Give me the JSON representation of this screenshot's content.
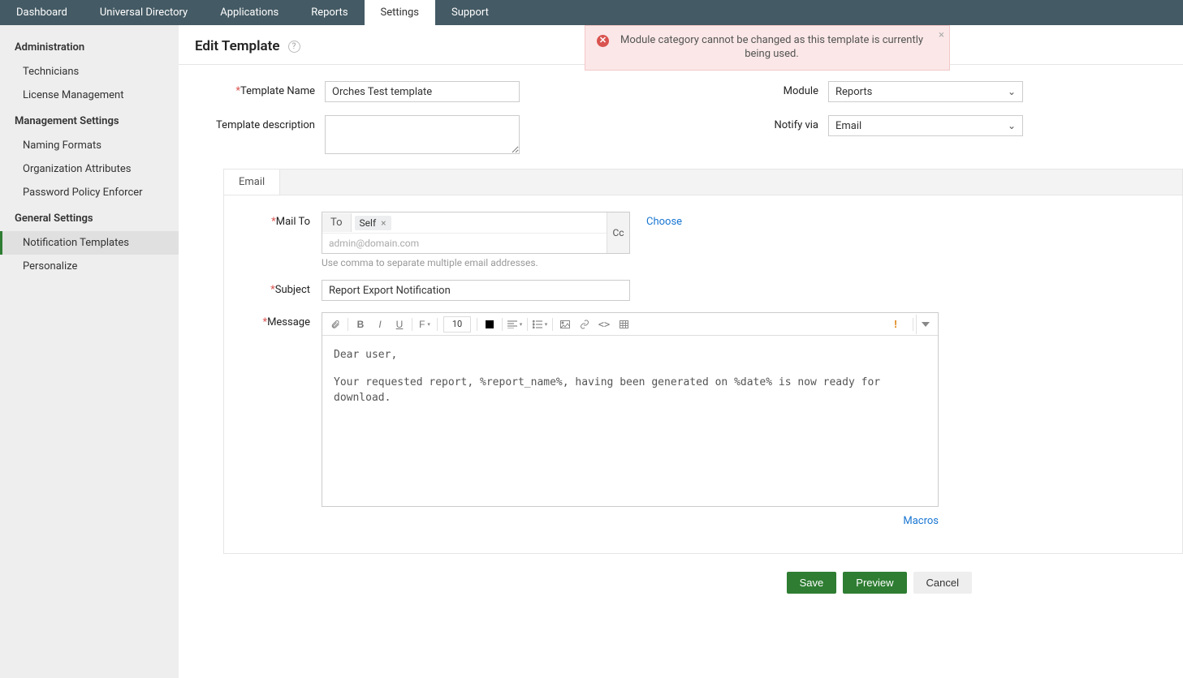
{
  "topnav": {
    "tabs": [
      "Dashboard",
      "Universal Directory",
      "Applications",
      "Reports",
      "Settings",
      "Support"
    ],
    "active_index": 4
  },
  "sidebar": {
    "sections": [
      {
        "title": "Administration",
        "items": [
          "Technicians",
          "License Management"
        ]
      },
      {
        "title": "Management Settings",
        "items": [
          "Naming Formats",
          "Organization Attributes",
          "Password Policy Enforcer"
        ]
      },
      {
        "title": "General Settings",
        "items": [
          "Notification Templates",
          "Personalize"
        ]
      }
    ],
    "active": "Notification Templates"
  },
  "page": {
    "title": "Edit Template"
  },
  "alert": {
    "message": "Module category cannot be changed as this template is currently being used."
  },
  "form": {
    "template_name": {
      "label": "Template Name",
      "value": "Orches Test template",
      "required": true
    },
    "template_description": {
      "label": "Template description",
      "value": "",
      "required": false
    },
    "module": {
      "label": "Module",
      "value": "Reports",
      "required": false
    },
    "notify_via": {
      "label": "Notify via",
      "value": "Email",
      "required": false
    }
  },
  "email_tab": {
    "tab_label": "Email",
    "mail_to": {
      "label": "Mail To",
      "to_label": "To",
      "chip": "Self",
      "cc_label": "Cc",
      "placeholder": "admin@domain.com",
      "hint": "Use comma to separate multiple email addresses.",
      "choose": "Choose",
      "required": true
    },
    "subject": {
      "label": "Subject",
      "value": "Report Export Notification",
      "required": true
    },
    "message": {
      "label": "Message",
      "required": true,
      "body_line1": "Dear user,",
      "body_line2": "Your requested report, %report_name%, having been generated on %date% is now ready for download."
    },
    "toolbar": {
      "font_size": "10"
    },
    "macros": "Macros"
  },
  "buttons": {
    "save": "Save",
    "preview": "Preview",
    "cancel": "Cancel"
  }
}
